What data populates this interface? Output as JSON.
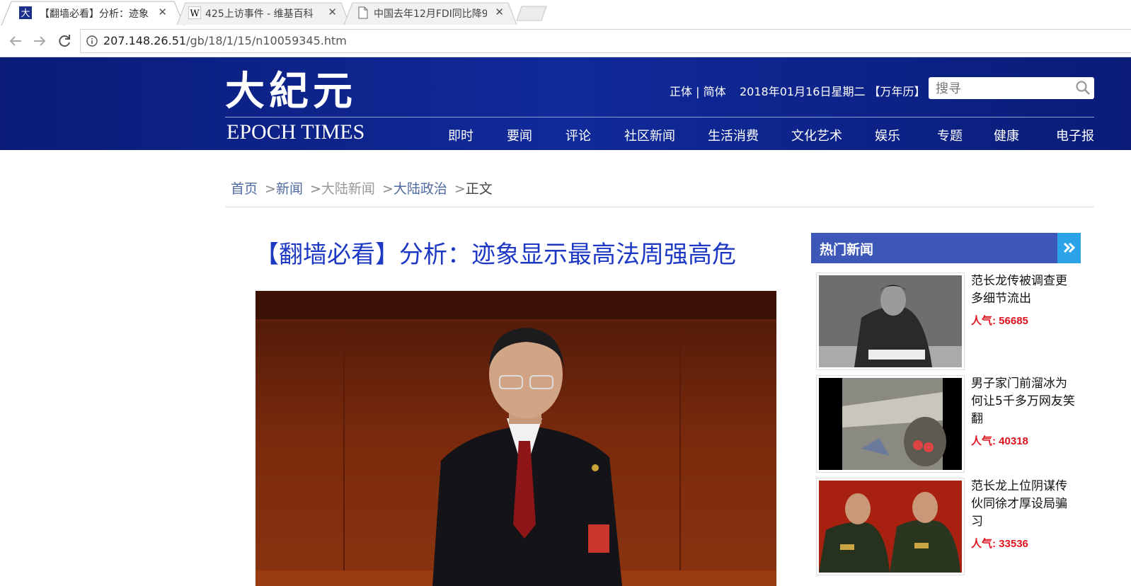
{
  "browser": {
    "tabs": [
      {
        "title": "【翻墙必看】分析：迹象",
        "active": true,
        "favicon": "epoch-times-favicon"
      },
      {
        "title": "425上访事件 - 维基百科",
        "active": false,
        "favicon": "wikipedia-favicon"
      },
      {
        "title": "中国去年12月FDI同比降9",
        "active": false,
        "favicon": "document-favicon"
      }
    ],
    "url_host": "207.148.26.51",
    "url_path": "/gb/18/1/15/n10059345.htm"
  },
  "header": {
    "logo_cn": "大紀元",
    "logo_en": "EPOCH TIMES",
    "langs": "正体 | 简体",
    "date": "2018年01月16日星期二 【万年历】",
    "search_placeholder": "搜寻",
    "nav": [
      "即时",
      "要闻",
      "评论",
      "社区新闻",
      "生活消费",
      "文化艺术",
      "娱乐",
      "专题",
      "健康",
      "电子报"
    ]
  },
  "breadcrumb": {
    "items": [
      "首页",
      "新闻",
      "大陆新闻",
      "大陆政治"
    ],
    "current": "正文"
  },
  "article": {
    "headline": "【翻墙必看】分析：迹象显示最高法周强高危"
  },
  "sidebar": {
    "title": "热门新闻",
    "items": [
      {
        "title": "范长龙传被调查更多细节流出",
        "views": "人气: 56685"
      },
      {
        "title": "男子家门前溜冰为何让5千多万网友笑翻",
        "views": "人气: 40318"
      },
      {
        "title": "范长龙上位阴谋传伙同徐才厚设局骗习",
        "views": "人气: 33536"
      }
    ]
  },
  "colors": {
    "header_bg": "#0f2796",
    "headline": "#1d39c4",
    "hot_header": "#3d57b8",
    "views_red": "#e0141e"
  }
}
